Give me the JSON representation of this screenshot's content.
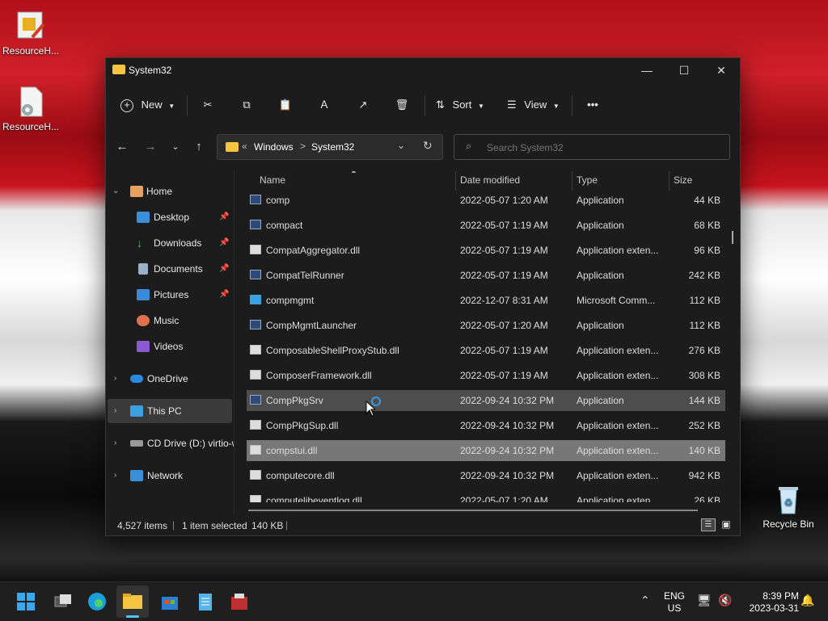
{
  "desktop": {
    "icons": [
      {
        "label": "ResourceH..."
      },
      {
        "label": "ResourceH..."
      },
      {
        "label": "Recycle Bin"
      }
    ]
  },
  "window": {
    "title": "System32",
    "controls": {
      "minimize": "—",
      "maximize": "☐",
      "close": "✕"
    }
  },
  "toolbar": {
    "new_label": "New",
    "sort_label": "Sort",
    "view_label": "View",
    "more_label": "•••"
  },
  "navigation": {
    "breadcrumb": [
      "Windows",
      "System32"
    ],
    "breadcrumb_prefix": "«",
    "separator": ">",
    "search_placeholder": "Search System32"
  },
  "sidebar": {
    "items": [
      {
        "label": "Home"
      },
      {
        "label": "Desktop"
      },
      {
        "label": "Downloads"
      },
      {
        "label": "Documents"
      },
      {
        "label": "Pictures"
      },
      {
        "label": "Music"
      },
      {
        "label": "Videos"
      },
      {
        "label": "OneDrive"
      },
      {
        "label": "This PC"
      },
      {
        "label": "CD Drive (D:) virtio-w"
      },
      {
        "label": "Network"
      }
    ]
  },
  "list": {
    "columns": {
      "name": "Name",
      "date": "Date modified",
      "type": "Type",
      "size": "Size"
    },
    "rows": [
      {
        "name": "comp",
        "date": "2022-05-07 1:20 AM",
        "type": "Application",
        "size": "44 KB"
      },
      {
        "name": "compact",
        "date": "2022-05-07 1:19 AM",
        "type": "Application",
        "size": "68 KB"
      },
      {
        "name": "CompatAggregator.dll",
        "date": "2022-05-07 1:19 AM",
        "type": "Application exten...",
        "size": "96 KB"
      },
      {
        "name": "CompatTelRunner",
        "date": "2022-05-07 1:19 AM",
        "type": "Application",
        "size": "242 KB"
      },
      {
        "name": "compmgmt",
        "date": "2022-12-07 8:31 AM",
        "type": "Microsoft Comm...",
        "size": "112 KB"
      },
      {
        "name": "CompMgmtLauncher",
        "date": "2022-05-07 1:20 AM",
        "type": "Application",
        "size": "112 KB"
      },
      {
        "name": "ComposableShellProxyStub.dll",
        "date": "2022-05-07 1:19 AM",
        "type": "Application exten...",
        "size": "276 KB"
      },
      {
        "name": "ComposerFramework.dll",
        "date": "2022-05-07 1:19 AM",
        "type": "Application exten...",
        "size": "308 KB"
      },
      {
        "name": "CompPkgSrv",
        "date": "2022-09-24 10:32 PM",
        "type": "Application",
        "size": "144 KB"
      },
      {
        "name": "CompPkgSup.dll",
        "date": "2022-09-24 10:32 PM",
        "type": "Application exten...",
        "size": "252 KB"
      },
      {
        "name": "compstui.dll",
        "date": "2022-09-24 10:32 PM",
        "type": "Application exten...",
        "size": "140 KB"
      },
      {
        "name": "computecore.dll",
        "date": "2022-09-24 10:32 PM",
        "type": "Application exten...",
        "size": "942 KB"
      },
      {
        "name": "computelibeventlog.dll",
        "date": "2022-05-07 1:20 AM",
        "type": "Application exten...",
        "size": "26 KB"
      }
    ]
  },
  "status": {
    "item_count": "4,527 items",
    "selection": "1 item selected",
    "selection_size": "140 KB"
  },
  "taskbar": {
    "lang_top": "ENG",
    "lang_bottom": "US",
    "time": "8:39 PM",
    "date": "2023-03-31"
  }
}
